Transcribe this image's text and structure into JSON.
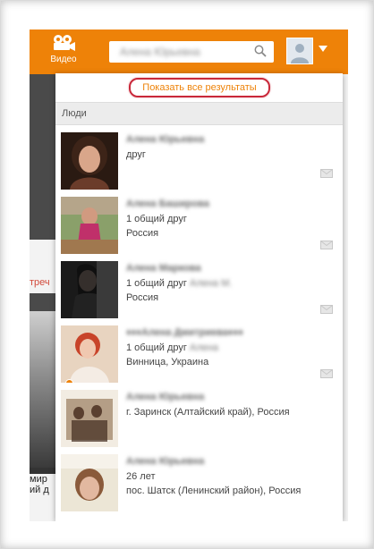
{
  "topbar": {
    "video_label": "Видео",
    "search_value": "Алена Юрьевна",
    "colors": {
      "accent": "#ee8208",
      "highlight": "#c9283a"
    }
  },
  "dropdown": {
    "show_all_label": "Показать все результаты",
    "section_label": "Люди",
    "results": [
      {
        "name": "Алена Юрьевна",
        "line1": "друг",
        "line2": "",
        "line3": "",
        "mutual_blur": "",
        "photo": "woman-dark-hair"
      },
      {
        "name": "Алена Баширова",
        "line1": "1 общий друг",
        "line2": "Россия",
        "line3": "",
        "mutual_blur": "",
        "photo": "woman-outdoors"
      },
      {
        "name": "Алена Маркова",
        "line1": "1 общий друг",
        "line2": "Россия",
        "line3": "",
        "mutual_blur": "Алена М.",
        "photo": "woman-black-dress"
      },
      {
        "name": "♦♦♦Алена Дмитриева♦♦♦",
        "line1": "1 общий друг",
        "line2": "Винница, Украина",
        "line3": "",
        "mutual_blur": "Алена",
        "photo": "woman-red-hair"
      },
      {
        "name": "Алена Юрьевна",
        "line1": "г. Заринск (Алтайский край), Россия",
        "line2": "",
        "line3": "",
        "mutual_blur": "",
        "photo": "family-sepia"
      },
      {
        "name": "Алена Юрьевна",
        "line1": "26 лет",
        "line2": "пос. Шатск (Ленинский район), Россия",
        "line3": "",
        "mutual_blur": "",
        "photo": "woman-light"
      }
    ]
  },
  "background": {
    "left_red_text": "треч",
    "bottom_text": "мир\nий д"
  }
}
